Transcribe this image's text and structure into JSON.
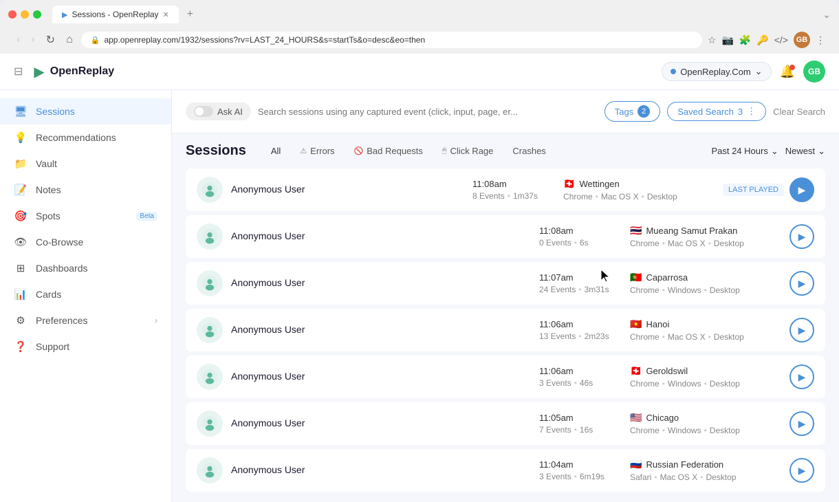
{
  "browser": {
    "tab_title": "Sessions - OpenReplay",
    "tab_icon": "▶",
    "url": "app.openreplay.com/1932/sessions?rv=LAST_24_HOURS&s=startTs&o=desc&eo=then",
    "more_icon": "⌄"
  },
  "header": {
    "logo_text": "OpenReplay",
    "org_name": "OpenReplay.Com",
    "notification_icon": "🔔",
    "user_initials": "GB"
  },
  "sidebar": {
    "items": [
      {
        "id": "sessions",
        "label": "Sessions",
        "icon": "🖥",
        "active": true
      },
      {
        "id": "recommendations",
        "label": "Recommendations",
        "icon": "💡",
        "active": false
      },
      {
        "id": "vault",
        "label": "Vault",
        "icon": "📁",
        "active": false
      },
      {
        "id": "notes",
        "label": "Notes",
        "icon": "📝",
        "active": false
      },
      {
        "id": "spots",
        "label": "Spots",
        "icon": "🎯",
        "active": false,
        "badge": "Beta"
      },
      {
        "id": "cobrowse",
        "label": "Co-Browse",
        "icon": "👁",
        "active": false
      },
      {
        "id": "dashboards",
        "label": "Dashboards",
        "icon": "⊞",
        "active": false
      },
      {
        "id": "cards",
        "label": "Cards",
        "icon": "📊",
        "active": false
      },
      {
        "id": "preferences",
        "label": "Preferences",
        "icon": "⚙",
        "active": false,
        "has_chevron": true
      },
      {
        "id": "support",
        "label": "Support",
        "icon": "❓",
        "active": false
      }
    ]
  },
  "search": {
    "ask_ai_label": "Ask AI",
    "placeholder": "Search sessions using any captured event (click, input, page, er...",
    "tags_label": "Tags",
    "tags_count": "2",
    "saved_search_label": "Saved Search",
    "saved_search_count": "3",
    "clear_label": "Clear Search"
  },
  "sessions_toolbar": {
    "title": "Sessions",
    "filters": [
      {
        "id": "all",
        "label": "All",
        "active": true
      },
      {
        "id": "errors",
        "label": "Errors",
        "icon": "⚠"
      },
      {
        "id": "bad_requests",
        "label": "Bad Requests",
        "icon": "🚫"
      },
      {
        "id": "click_rage",
        "label": "Click Rage",
        "icon": "🖱"
      },
      {
        "id": "crashes",
        "label": "Crashes",
        "icon": "💥"
      }
    ],
    "time_range": "Past 24 Hours",
    "sort": "Newest"
  },
  "sessions": [
    {
      "id": "s1",
      "user": "Anonymous User",
      "time": "11:08am",
      "events": "8 Events",
      "duration": "1m37s",
      "location": "Wettingen",
      "flag": "🇨🇭",
      "browser": "Chrome",
      "os": "Mac OS X",
      "device": "Desktop",
      "last_played": true,
      "play_active": true
    },
    {
      "id": "s2",
      "user": "Anonymous User",
      "time": "11:08am",
      "events": "0 Events",
      "duration": "6s",
      "location": "Mueang Samut Prakan",
      "flag": "🇹🇭",
      "browser": "Chrome",
      "os": "Mac OS X",
      "device": "Desktop",
      "last_played": false,
      "play_active": false
    },
    {
      "id": "s3",
      "user": "Anonymous User",
      "time": "11:07am",
      "events": "24 Events",
      "duration": "3m31s",
      "location": "Caparrosa",
      "flag": "🇵🇹",
      "browser": "Chrome",
      "os": "Windows",
      "device": "Desktop",
      "last_played": false,
      "play_active": false
    },
    {
      "id": "s4",
      "user": "Anonymous User",
      "time": "11:06am",
      "events": "13 Events",
      "duration": "2m23s",
      "location": "Hanoi",
      "flag": "🇻🇳",
      "browser": "Chrome",
      "os": "Mac OS X",
      "device": "Desktop",
      "last_played": false,
      "play_active": false
    },
    {
      "id": "s5",
      "user": "Anonymous User",
      "time": "11:06am",
      "events": "3 Events",
      "duration": "46s",
      "location": "Geroldswil",
      "flag": "🇨🇭",
      "browser": "Chrome",
      "os": "Windows",
      "device": "Desktop",
      "last_played": false,
      "play_active": false
    },
    {
      "id": "s6",
      "user": "Anonymous User",
      "time": "11:05am",
      "events": "7 Events",
      "duration": "16s",
      "location": "Chicago",
      "flag": "🇺🇸",
      "browser": "Chrome",
      "os": "Windows",
      "device": "Desktop",
      "last_played": false,
      "play_active": false
    },
    {
      "id": "s7",
      "user": "Anonymous User",
      "time": "11:04am",
      "events": "3 Events",
      "duration": "6m19s",
      "location": "Russian Federation",
      "flag": "🇷🇺",
      "browser": "Safari",
      "os": "Mac OS X",
      "device": "Desktop",
      "last_played": false,
      "play_active": false
    }
  ],
  "colors": {
    "accent": "#4a90d9",
    "active_sidebar": "#4a90d9",
    "avatar_bg": "#2ecc71"
  }
}
